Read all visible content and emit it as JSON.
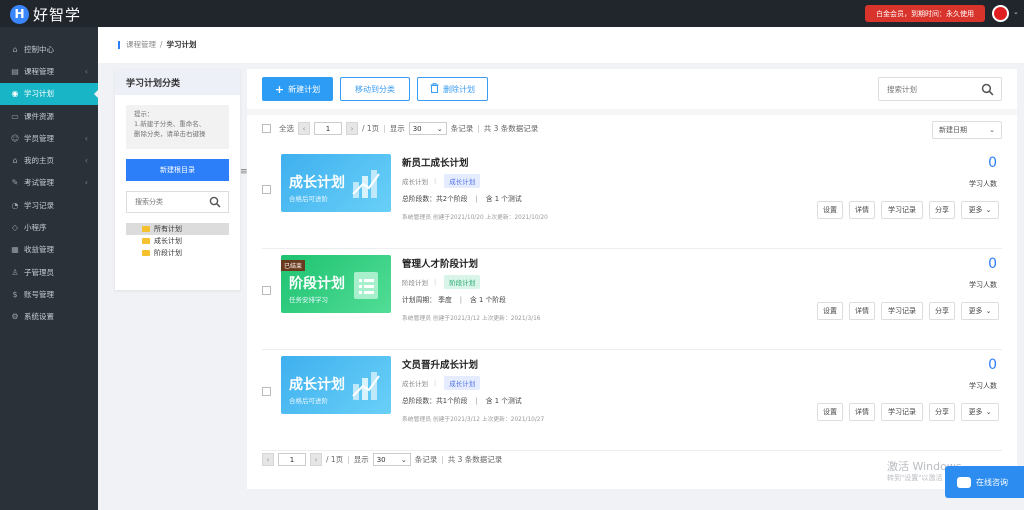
{
  "app": {
    "logo_letter": "H",
    "logo_text": "好智学"
  },
  "header": {
    "membership": "白金会员，到期时间：永久使用"
  },
  "sidebar": {
    "items": [
      {
        "label": "控制中心",
        "icon": "home-icon",
        "arrow": false
      },
      {
        "label": "课程管理",
        "icon": "folder-icon",
        "arrow": true
      },
      {
        "label": "学习计划",
        "icon": "eye-icon",
        "arrow": false,
        "active": true
      },
      {
        "label": "课件资源",
        "icon": "document-icon",
        "arrow": false
      },
      {
        "label": "学员管理",
        "icon": "users-icon",
        "arrow": true
      },
      {
        "label": "我的主页",
        "icon": "home-icon",
        "arrow": true
      },
      {
        "label": "考试管理",
        "icon": "exam-icon",
        "arrow": true
      },
      {
        "label": "学习记录",
        "icon": "record-icon",
        "arrow": false
      },
      {
        "label": "小程序",
        "icon": "miniapp-icon",
        "arrow": false
      },
      {
        "label": "收益管理",
        "icon": "wallet-icon",
        "arrow": false
      },
      {
        "label": "子管理员",
        "icon": "user-icon",
        "arrow": false
      },
      {
        "label": "账号管理",
        "icon": "dollar-icon",
        "arrow": false
      },
      {
        "label": "系统设置",
        "icon": "gear-icon",
        "arrow": false
      }
    ]
  },
  "breadcrumb": {
    "parent": "课程管理",
    "separator": "/",
    "current": "学习计划"
  },
  "category_panel": {
    "title": "学习计划分类",
    "tip_lines": [
      "提示：",
      "1.新建子分类、重命名、",
      "删除分类，请单击右键操"
    ],
    "new_dir_button": "新建根目录",
    "search_placeholder": "搜索分类",
    "tree": [
      {
        "label": "所有计划",
        "selected": true
      },
      {
        "label": "成长计划",
        "selected": false
      },
      {
        "label": "阶段计划",
        "selected": false
      }
    ]
  },
  "toolbar": {
    "new_plan": "新建计划",
    "move_to_category": "移动到分类",
    "delete_plan": "删除计划",
    "search_placeholder": "搜索计划"
  },
  "pager": {
    "select_all": "全选",
    "page": "1",
    "total_pages": "/ 1页",
    "show_label": "显示",
    "page_size": "30",
    "records_label": "条记录",
    "total_records": "共 3 条数据记录"
  },
  "sort": {
    "selected": "新建日期"
  },
  "plans": [
    {
      "title": "新员工成长计划",
      "category": "成长计划",
      "tag": "成长计划",
      "tag_color": "blue",
      "detail_left": "总阶段数：共2个阶段",
      "detail_right": "含 1 个测试",
      "meta": "系统管理员 创建于2021/10/20 上次更新：2021/10/20",
      "thumb_text": "成长计划",
      "thumb_sub": "合格后可进阶",
      "thumb_color": "blue",
      "thumb_badge": "",
      "learners": "0",
      "learners_label": "学习人数"
    },
    {
      "title": "管理人才阶段计划",
      "category": "阶段计划",
      "tag": "阶段计划",
      "tag_color": "green",
      "detail_left": "计划周期：  季度",
      "detail_right": "含 1 个阶段",
      "meta": "系统管理员 创建于2021/3/12 上次更新：2021/3/16",
      "thumb_text": "阶段计划",
      "thumb_sub": "任务安排学习",
      "thumb_color": "green",
      "thumb_badge": "已结束",
      "learners": "0",
      "learners_label": "学习人数"
    },
    {
      "title": "文员晋升成长计划",
      "category": "成长计划",
      "tag": "成长计划",
      "tag_color": "blue",
      "detail_left": "总阶段数：共1个阶段",
      "detail_right": "含 1 个测试",
      "meta": "系统管理员 创建于2021/3/12 上次更新：2021/10/27",
      "thumb_text": "成长计划",
      "thumb_sub": "合格后可进阶",
      "thumb_color": "blue",
      "thumb_badge": "",
      "learners": "0",
      "learners_label": "学习人数"
    }
  ],
  "plan_actions": [
    "设置",
    "详情",
    "学习记录",
    "分享",
    "更多"
  ],
  "watermark": {
    "line1": "激活 Windows",
    "line2": "转到\"设置\"以激活"
  },
  "consult": {
    "label": "在线咨询"
  },
  "colors": {
    "primary": "#2d7ff9",
    "sidebar_bg": "#2b3139",
    "active_menu": "#18b5c6",
    "vip_red": "#d9342b"
  }
}
